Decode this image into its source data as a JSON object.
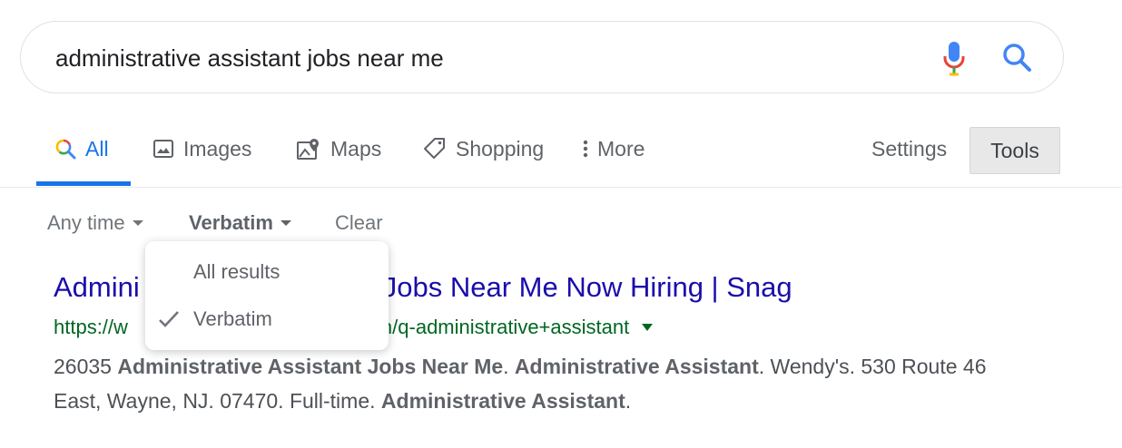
{
  "search": {
    "query": "administrative assistant jobs near me"
  },
  "tabs": [
    {
      "label": "All",
      "icon": "google-search-icon",
      "active": true
    },
    {
      "label": "Images",
      "icon": "image-icon"
    },
    {
      "label": "Maps",
      "icon": "map-pin-icon"
    },
    {
      "label": "Shopping",
      "icon": "tag-icon"
    },
    {
      "label": "More",
      "icon": "more-vert-icon"
    }
  ],
  "settings_label": "Settings",
  "tools_label": "Tools",
  "filters": {
    "time": "Any time",
    "verbatim": "Verbatim",
    "clear": "Clear"
  },
  "dropdown": {
    "items": [
      {
        "label": "All results",
        "checked": false
      },
      {
        "label": "Verbatim",
        "checked": true
      }
    ]
  },
  "result": {
    "title_start": "Admini",
    "title_end": "Jobs Near Me Now Hiring | Snag",
    "url_start": "https://w",
    "url_end": "ch/q-administrative+assistant",
    "snippet": [
      {
        "t": "26035 ",
        "b": false
      },
      {
        "t": "Administrative Assistant Jobs Near Me",
        "b": true
      },
      {
        "t": ". ",
        "b": false
      },
      {
        "t": "Administrative Assistant",
        "b": true
      },
      {
        "t": ". Wendy's. 530 Route 46 East, Wayne, NJ. 07470. Full-time. ",
        "b": false
      },
      {
        "t": "Administrative Assistant",
        "b": true
      },
      {
        "t": ".",
        "b": false
      }
    ]
  },
  "colors": {
    "link": "#1a0dab",
    "url": "#006621",
    "accent": "#1a73e8"
  }
}
